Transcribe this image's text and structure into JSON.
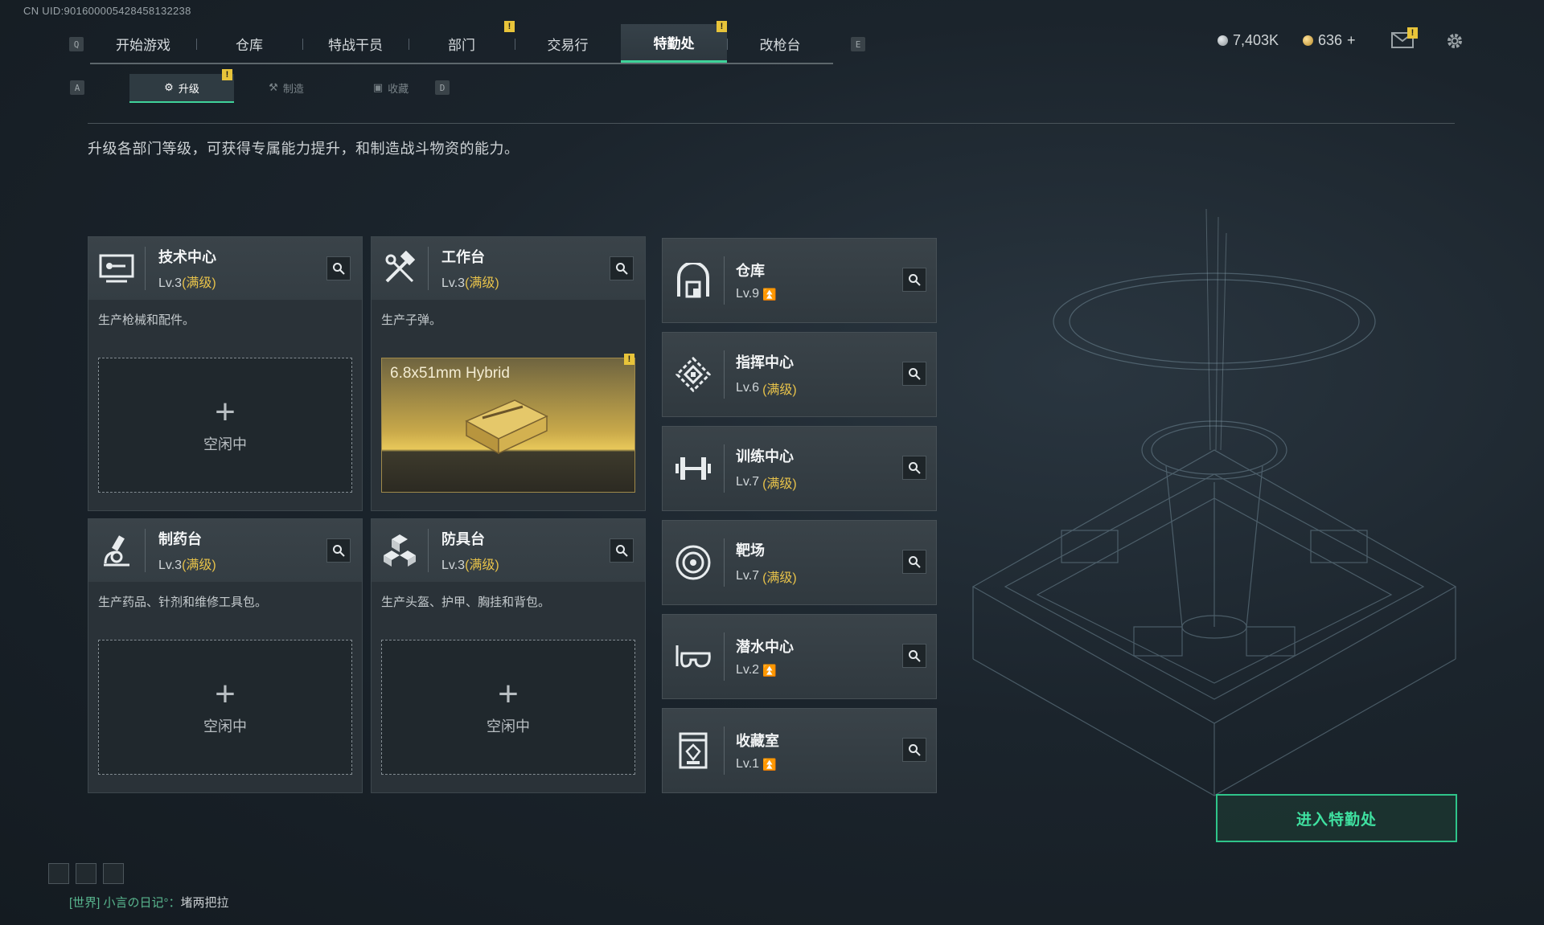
{
  "uid": "CN UID:9016000054284581322​38",
  "nav": {
    "key_left": "Q",
    "key_right": "E",
    "tabs": [
      {
        "label": "开始游戏",
        "alert": false
      },
      {
        "label": "仓库",
        "alert": false
      },
      {
        "label": "特战干员",
        "alert": false
      },
      {
        "label": "部门",
        "alert": true
      },
      {
        "label": "交易行",
        "alert": false
      },
      {
        "label": "特勤处",
        "alert": true,
        "active": true
      },
      {
        "label": "改枪台",
        "alert": false
      }
    ]
  },
  "currency": {
    "silver": "7,403K",
    "gold": "636",
    "gold_add": "+"
  },
  "alerts": {
    "mark": "!"
  },
  "subnav": {
    "key_left": "A",
    "key_right": "D",
    "tabs": [
      {
        "label": "升级",
        "active": true,
        "alert": true
      },
      {
        "label": "制造",
        "active": false
      },
      {
        "label": "收藏",
        "active": false
      }
    ]
  },
  "description": "升级各部门等级，可获得专属能力提升，和制造战斗物资的能力。",
  "workbenches": [
    {
      "title": "技术中心",
      "level": "Lv.3",
      "max": "(满级)",
      "desc": "生产枪械和配件。",
      "slot": "空闲中"
    },
    {
      "title": "工作台",
      "level": "Lv.3",
      "max": "(满级)",
      "desc": "生产子弹。",
      "product": "6.8x51mm Hybrid"
    },
    {
      "title": "制药台",
      "level": "Lv.3",
      "max": "(满级)",
      "desc": "生产药品、针剂和维修工具包。",
      "slot": "空闲中"
    },
    {
      "title": "防具台",
      "level": "Lv.3",
      "max": "(满级)",
      "desc": "生产头盔、护甲、胸挂和背包。",
      "slot": "空闲中"
    }
  ],
  "slot_plus": "+",
  "departments": [
    {
      "title": "仓库",
      "level": "Lv.9",
      "max": "",
      "upgrade": true
    },
    {
      "title": "指挥中心",
      "level": "Lv.6",
      "max": "(满级)",
      "upgrade": false
    },
    {
      "title": "训练中心",
      "level": "Lv.7",
      "max": "(满级)",
      "upgrade": false
    },
    {
      "title": "靶场",
      "level": "Lv.7",
      "max": "(满级)",
      "upgrade": false
    },
    {
      "title": "潜水中心",
      "level": "Lv.2",
      "max": "",
      "upgrade": true
    },
    {
      "title": "收藏室",
      "level": "Lv.1",
      "max": "",
      "upgrade": true
    }
  ],
  "enter_button": "进入特勤处",
  "chat": {
    "channel": "[世界]",
    "user": "小言の日记°",
    "sep": "：",
    "message": "堵两把拉"
  },
  "colors": {
    "accent": "#3fd39a",
    "gold": "#e7c24a",
    "warning": "#e8c43a"
  }
}
